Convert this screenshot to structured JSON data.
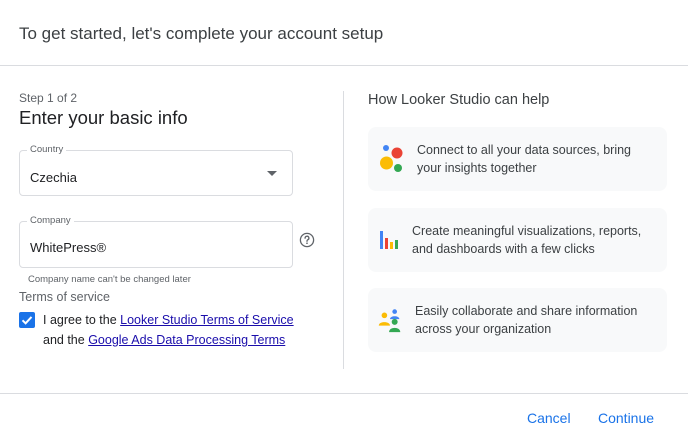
{
  "header": {
    "title": "To get started, let's complete your account setup"
  },
  "form": {
    "step": "Step 1 of 2",
    "title": "Enter your basic info",
    "country": {
      "label": "Country",
      "value": "Czechia"
    },
    "company": {
      "label": "Company",
      "value": "WhitePress®",
      "helper": "Company name can't be changed later"
    },
    "tos": {
      "heading": "Terms of service",
      "checked": true,
      "text_before": "I agree to the",
      "link1": "Looker Studio Terms of Service",
      "text_mid": "and the",
      "link2": "Google Ads Data Processing Terms"
    }
  },
  "help": {
    "title": "How Looker Studio can help",
    "cards": [
      {
        "icon": "data-sources-icon",
        "text": "Connect to all your data sources, bring your insights together"
      },
      {
        "icon": "bar-chart-icon",
        "text": "Create meaningful visualizations, reports, and dashboards with a few clicks"
      },
      {
        "icon": "people-icon",
        "text": "Easily collaborate and share information across your organization"
      }
    ]
  },
  "footer": {
    "cancel_label": "Cancel",
    "continue_label": "Continue"
  },
  "colors": {
    "accent": "#1a73e8",
    "link": "#1a0dab",
    "card_bg": "#f8f9fa",
    "divider": "#dadce0"
  }
}
